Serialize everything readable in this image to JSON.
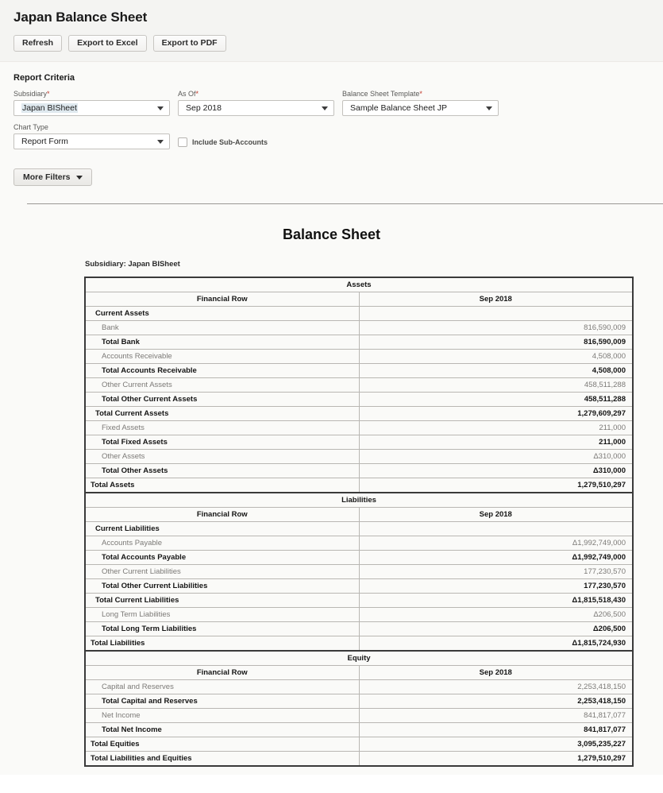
{
  "header": {
    "title": "Japan Balance Sheet",
    "buttons": [
      {
        "label": "Refresh",
        "name": "refresh-button"
      },
      {
        "label": "Export to Excel",
        "name": "export-excel-button"
      },
      {
        "label": "Export to PDF",
        "name": "export-pdf-button"
      }
    ]
  },
  "criteria": {
    "section_title": "Report Criteria",
    "subsidiary": {
      "label": "Subsidiary",
      "required": "*",
      "value": "Japan BISheet"
    },
    "as_of": {
      "label": "As Of",
      "required": "*",
      "value": "Sep 2018"
    },
    "template": {
      "label": "Balance Sheet Template",
      "required": "*",
      "value": "Sample Balance Sheet JP"
    },
    "chart_type": {
      "label": "Chart Type",
      "required": "",
      "value": "Report Form"
    },
    "include_sub_accounts": {
      "label": "Include Sub-Accounts",
      "checked": false
    },
    "more_filters": {
      "label": "More Filters"
    }
  },
  "report": {
    "title": "Balance Sheet",
    "subsidiary_line": "Subsidiary: Japan BISheet",
    "column_header_label": "Financial Row",
    "period": "Sep 2018",
    "sections": [
      {
        "name": "Assets",
        "rows": [
          {
            "label": "Current Assets",
            "value": "",
            "type": "group"
          },
          {
            "label": "Bank",
            "value": "816,590,009",
            "type": "detail"
          },
          {
            "label": "Total Bank",
            "value": "816,590,009",
            "type": "total"
          },
          {
            "label": "Accounts Receivable",
            "value": "4,508,000",
            "type": "detail"
          },
          {
            "label": "Total Accounts Receivable",
            "value": "4,508,000",
            "type": "total"
          },
          {
            "label": "Other Current Assets",
            "value": "458,511,288",
            "type": "detail"
          },
          {
            "label": "Total Other Current Assets",
            "value": "458,511,288",
            "type": "total"
          },
          {
            "label": "Total Current Assets",
            "value": "1,279,609,297",
            "type": "total-l1"
          },
          {
            "label": "Fixed Assets",
            "value": "211,000",
            "type": "detail"
          },
          {
            "label": "Total Fixed Assets",
            "value": "211,000",
            "type": "total"
          },
          {
            "label": "Other Assets",
            "value": "Δ310,000",
            "type": "detail"
          },
          {
            "label": "Total Other Assets",
            "value": "Δ310,000",
            "type": "total"
          },
          {
            "label": "Total Assets",
            "value": "1,279,510,297",
            "type": "total-l0"
          }
        ]
      },
      {
        "name": "Liabilities",
        "rows": [
          {
            "label": "Current Liabilities",
            "value": "",
            "type": "group"
          },
          {
            "label": "Accounts Payable",
            "value": "Δ1,992,749,000",
            "type": "detail"
          },
          {
            "label": "Total Accounts Payable",
            "value": "Δ1,992,749,000",
            "type": "total"
          },
          {
            "label": "Other Current Liabilities",
            "value": "177,230,570",
            "type": "detail"
          },
          {
            "label": "Total Other Current Liabilities",
            "value": "177,230,570",
            "type": "total"
          },
          {
            "label": "Total Current Liabilities",
            "value": "Δ1,815,518,430",
            "type": "total-l1"
          },
          {
            "label": "Long Term Liabilities",
            "value": "Δ206,500",
            "type": "detail"
          },
          {
            "label": "Total Long Term Liabilities",
            "value": "Δ206,500",
            "type": "total"
          },
          {
            "label": "Total Liabilities",
            "value": "Δ1,815,724,930",
            "type": "total-l0"
          }
        ]
      },
      {
        "name": "Equity",
        "rows": [
          {
            "label": "Capital and Reserves",
            "value": "2,253,418,150",
            "type": "detail"
          },
          {
            "label": "Total Capital and Reserves",
            "value": "2,253,418,150",
            "type": "total"
          },
          {
            "label": "Net Income",
            "value": "841,817,077",
            "type": "detail"
          },
          {
            "label": "Total Net Income",
            "value": "841,817,077",
            "type": "total"
          },
          {
            "label": "Total Equities",
            "value": "3,095,235,227",
            "type": "total-l0"
          },
          {
            "label": "Total Liabilities and Equities",
            "value": "1,279,510,297",
            "type": "total-l0"
          }
        ]
      }
    ]
  },
  "colors": {
    "header_bg": "#f4f4f2",
    "body_bg": "#fafaf8",
    "required_marker": "#c0392b",
    "table_border": "#3a3a3a",
    "detail_text": "#7c7a77",
    "selection_highlight": "#dfe9ef"
  }
}
